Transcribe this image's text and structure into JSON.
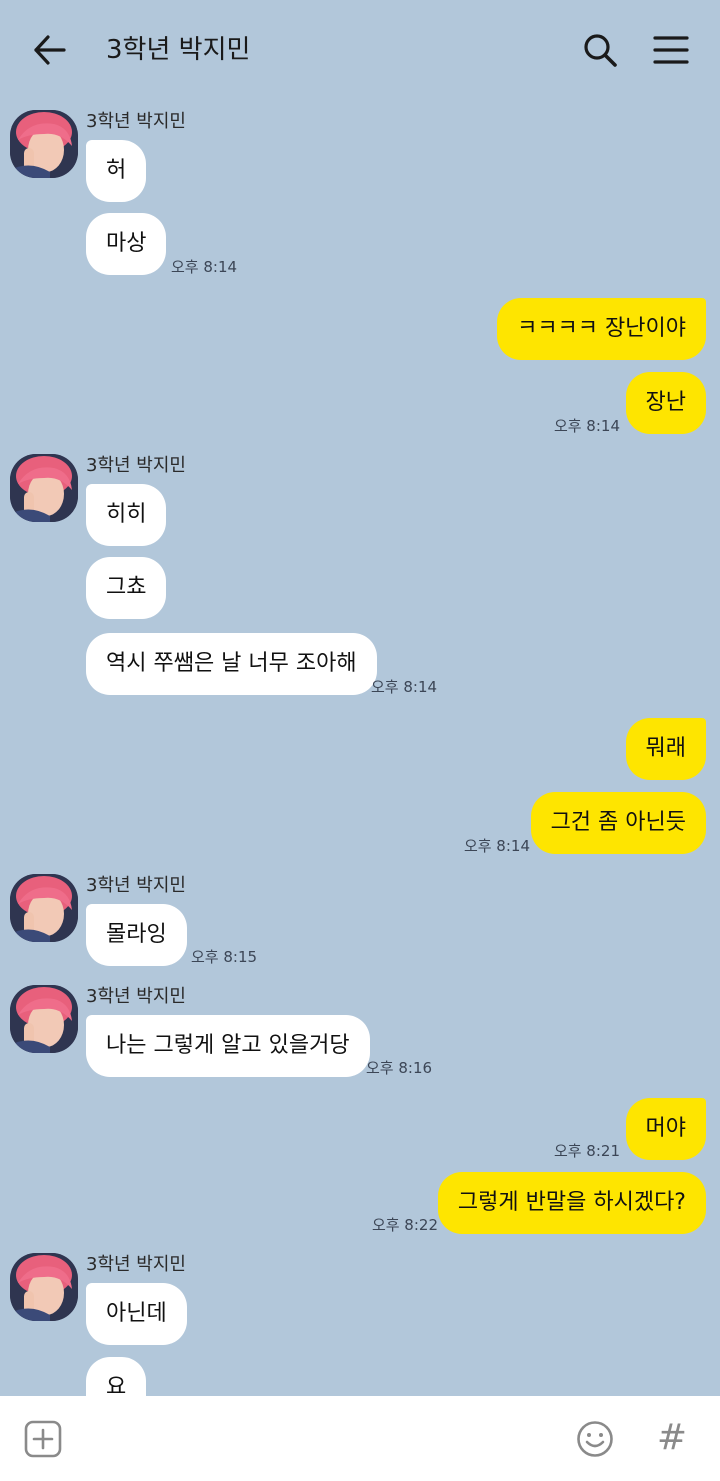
{
  "header": {
    "back_icon": "arrow-left-icon",
    "title": "3학년 박지민",
    "search_icon": "search-icon",
    "menu_icon": "hamburger-menu-icon"
  },
  "messages": [
    {
      "from": "contact",
      "sender": "3학년 박지민",
      "text": "허"
    },
    {
      "from": "contact",
      "text": "마상",
      "time": "오후 8:14"
    },
    {
      "from": "me",
      "text": "ㅋㅋㅋㅋ 장난이야"
    },
    {
      "from": "me",
      "text": "장난",
      "time": "오후 8:14"
    },
    {
      "from": "contact",
      "sender": "3학년 박지민",
      "text": "히히"
    },
    {
      "from": "contact",
      "text": "그쵸"
    },
    {
      "from": "contact",
      "text": "역시 쭈쌤은 날 너무 조아해",
      "time": "오후 8:14"
    },
    {
      "from": "me",
      "text": "뭐래"
    },
    {
      "from": "me",
      "text": "그건 좀 아닌듯",
      "time": "오후 8:14"
    },
    {
      "from": "contact",
      "sender": "3학년 박지민",
      "text": "몰라잉",
      "time": "오후 8:15"
    },
    {
      "from": "contact",
      "sender": "3학년 박지민",
      "text": "나는 그렇게 알고 있을거당",
      "time": "오후 8:16"
    },
    {
      "from": "me",
      "text": "머야",
      "time": "오후 8:21"
    },
    {
      "from": "me",
      "text": "그렇게 반말을 하시겠다?",
      "time": "오후 8:22"
    },
    {
      "from": "contact",
      "sender": "3학년 박지민",
      "text": "아닌데"
    },
    {
      "from": "contact",
      "text": "요"
    }
  ],
  "input_bar": {
    "plus_icon": "plus-square-icon",
    "emoji_icon": "emoji-smile-icon",
    "hash_label": "#"
  },
  "colors": {
    "chat_background": "#b2c7da",
    "my_bubble": "#fee500",
    "contact_bubble": "#ffffff"
  }
}
